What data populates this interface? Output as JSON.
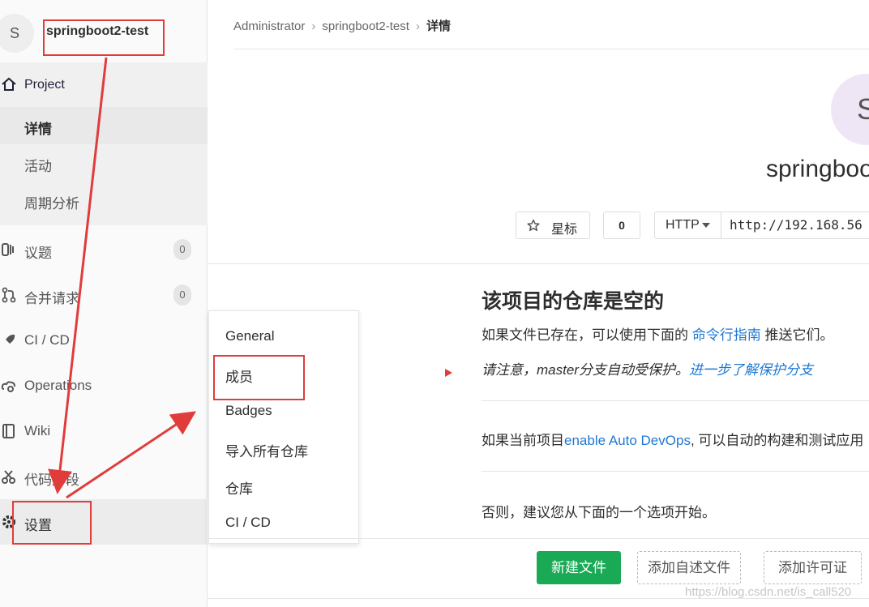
{
  "project": {
    "avatar_letter": "S",
    "name": "springboot2-test"
  },
  "sidebar": {
    "project_label": "Project",
    "sub_items": [
      "详情",
      "活动",
      "周期分析"
    ],
    "items": [
      {
        "label": "议题",
        "badge": "0",
        "icon": "issues-icon"
      },
      {
        "label": "合并请求",
        "badge": "0",
        "icon": "merge-request-icon"
      },
      {
        "label": "CI / CD",
        "icon": "rocket-icon"
      },
      {
        "label": "Operations",
        "icon": "cloud-gear-icon"
      },
      {
        "label": "Wiki",
        "icon": "book-icon"
      },
      {
        "label": "代码片段",
        "icon": "scissors-icon"
      },
      {
        "label": "设置",
        "icon": "gear-icon"
      }
    ]
  },
  "settings_menu": {
    "items": [
      "General",
      "成员",
      "Badges",
      "导入所有仓库",
      "仓库",
      "CI / CD"
    ]
  },
  "breadcrumb": {
    "items": [
      "Administrator",
      "springboot2-test",
      "详情"
    ]
  },
  "main": {
    "avatar_letter": "S",
    "title": "springboo",
    "star_label": "星标",
    "star_count": "0",
    "clone_protocol": "HTTP",
    "clone_url": "http://192.168.56",
    "empty_title": "该项目的仓库是空的",
    "line1_prefix": "如果文件已存在，可以使用下面的 ",
    "line1_link": "命令行指南",
    "line1_suffix": " 推送它们。",
    "line2_prefix": "请注意，master分支自动受保护。",
    "line2_link": "进一步了解保护分支",
    "line3_prefix": "如果当前项目",
    "line3_link": "enable Auto DevOps",
    "line3_suffix": ", 可以自动的构建和测试应用",
    "line4": "否则，建议您从下面的一个选项开始。",
    "btn_new_file": "新建文件",
    "btn_add_readme": "添加自述文件",
    "btn_add_license": "添加许可证"
  },
  "watermark": "https://blog.csdn.net/is_call520",
  "colors": {
    "accent_red": "#e03c3c",
    "link_blue": "#1f78d1",
    "success_green": "#1aaa55"
  }
}
